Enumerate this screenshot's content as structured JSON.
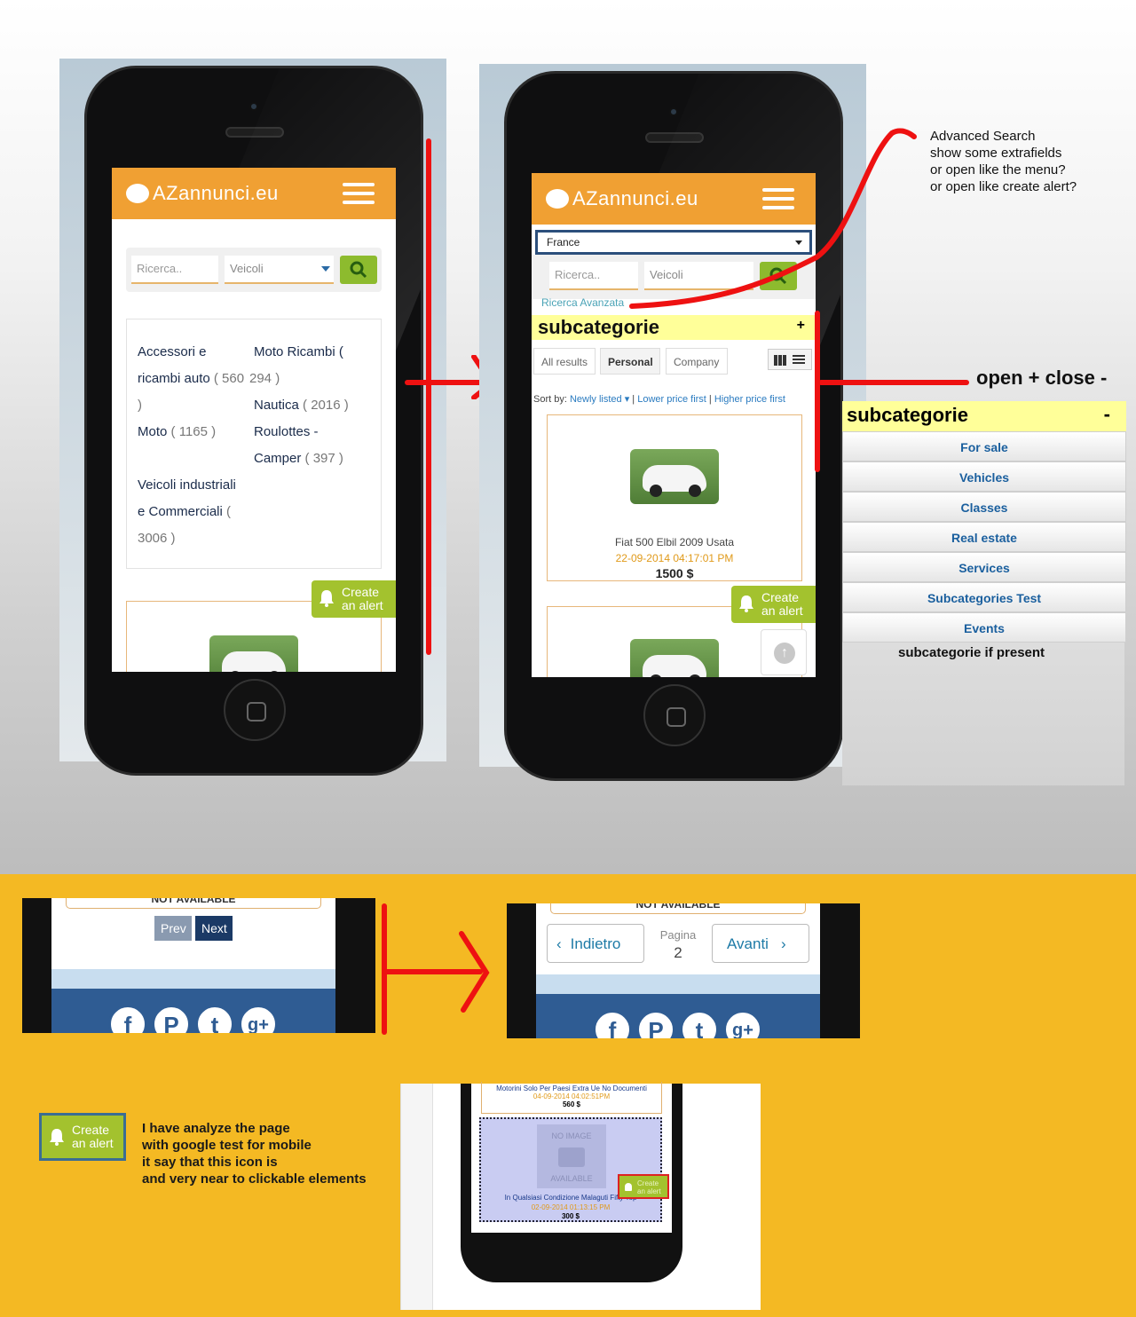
{
  "phone1": {
    "logo": "AZannunci.eu",
    "search_placeholder": "Ricerca..",
    "category_select": "Veicoli",
    "categories": [
      {
        "line1": "Accessori e",
        "line2": "ricambi auto",
        "count": "( 560",
        "tail": ")"
      },
      {
        "line1": "Moto Ricambi (",
        "count": "294 )"
      },
      {
        "line1": "Nautica",
        "count": "( 2016 )"
      },
      {
        "line1": "Moto",
        "count": "( 1165 )"
      },
      {
        "line1": "Roulottes -",
        "line2": "Camper",
        "count": "( 397 )"
      },
      {
        "line1": "Veicoli industriali",
        "line2": "e Commerciali",
        "line2_tail": "(",
        "count": "3006 )"
      }
    ],
    "alert_line1": "Create",
    "alert_line2": "an alert"
  },
  "phone2": {
    "logo": "AZannunci.eu",
    "country": "France",
    "search_placeholder": "Ricerca..",
    "category_select": "Veicoli",
    "advanced_link": "Ricerca Avanzata",
    "subcat_title": "subcategorie",
    "subcat_toggle": "+",
    "tabs": [
      "All results",
      "Personal",
      "Company"
    ],
    "sort_label": "Sort by:",
    "sort_options": [
      "Newly listed",
      "Lower price first",
      "Higher price first"
    ],
    "listing": {
      "title": "Fiat 500 Elbil 2009 Usata",
      "date": "22-09-2014   04:17:01 PM",
      "price": "1500 $"
    },
    "alert_line1": "Create",
    "alert_line2": "an alert"
  },
  "annotations": {
    "advanced": [
      "Advanced Search",
      "show some extrafields",
      "or open like the menu?",
      "or open like create alert?"
    ],
    "open_close": "open + close -",
    "subcat_present": "subcategorie if present",
    "mobile_test": [
      "I have analyze the page",
      "with google test for mobile",
      "it say that this icon is",
      "and very near to clickable elements"
    ]
  },
  "subcat_panel": {
    "title": "subcategorie",
    "toggle": "-",
    "items": [
      "For sale",
      "Vehicles",
      "Classes",
      "Real estate",
      "Services",
      "Subcategories Test",
      "Events"
    ]
  },
  "pager_old": {
    "not_available": "NOT AVAILABLE",
    "prev": "Prev",
    "next": "Next"
  },
  "pager_new": {
    "not_available": "NOT AVAILABLE",
    "back": "Indietro",
    "page_label": "Pagina",
    "page_number": "2",
    "forward": "Avanti"
  },
  "social_icons": [
    "f",
    "P",
    "t",
    "g+"
  ],
  "alert_example": {
    "line1": "Create",
    "line2": "an alert"
  },
  "mobile_shot": {
    "item1_title": "Motorini Solo Per Paesi Extra Ue No Documenti",
    "item1_date": "04-09-2014   04:02:51PM",
    "item1_price": "560 $",
    "no_image_top": "NO IMAGE",
    "no_image_bottom": "AVAILABLE",
    "item2_title": "In Qualsiasi Condizione Malaguti Fifty Top",
    "item2_date": "02-09-2014   01:13:15 PM",
    "item2_price": "300 $",
    "alert_line1": "Create",
    "alert_line2": "an alert"
  },
  "colors": {
    "brand_orange": "#f0a033",
    "alert_green": "#a3c22e",
    "annotation_red": "#e11111",
    "subcat_yellow": "#ffff99",
    "link_blue": "#1a5f9e"
  }
}
